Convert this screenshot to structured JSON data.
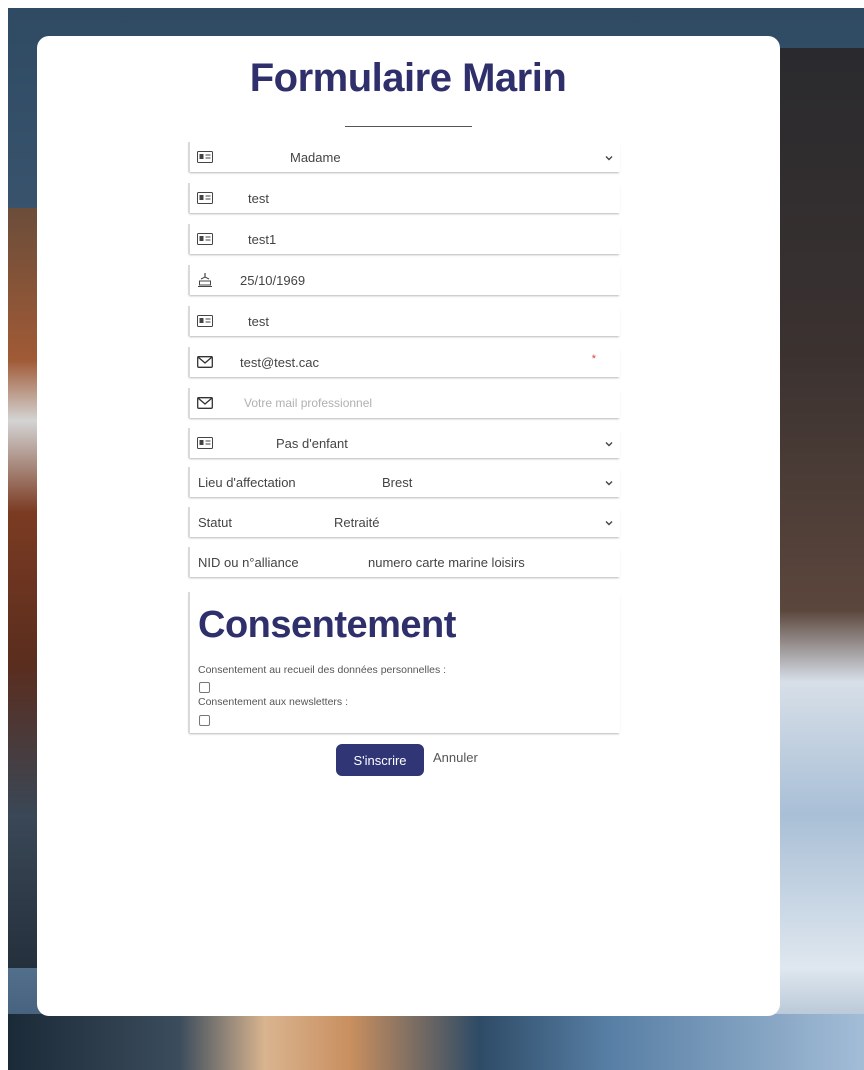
{
  "page": {
    "title": "Formulaire Marin"
  },
  "form": {
    "civility": {
      "value": "Madame",
      "icon": "id-card-icon"
    },
    "first_name": {
      "value": "test",
      "icon": "id-card-icon"
    },
    "last_name": {
      "value": "test1",
      "icon": "id-card-icon"
    },
    "birth_date": {
      "value": "25/10/1969",
      "icon": "cake-icon"
    },
    "field5": {
      "value": "test",
      "icon": "id-card-icon"
    },
    "email": {
      "value": "test@test.cac",
      "required_mark": "*",
      "icon": "mail-icon"
    },
    "pro_email": {
      "placeholder": "Votre mail professionnel",
      "icon": "mail-icon"
    },
    "children": {
      "value": "Pas d'enfant",
      "icon": "id-card-icon"
    },
    "assignment": {
      "label": "Lieu d'affectation",
      "value": "Brest"
    },
    "status": {
      "label": "Statut",
      "value": "Retraité"
    },
    "nid": {
      "label": "NID ou n°alliance",
      "placeholder": "numero carte marine loisirs"
    }
  },
  "consent": {
    "title": "Consentement",
    "personal_data_label": "Consentement au recueil des données personnelles :",
    "newsletter_label": "Consentement aux newsletters :"
  },
  "actions": {
    "submit_label": "S'inscrire",
    "cancel_label": "Annuler"
  },
  "colors": {
    "accent": "#2e2f6b",
    "button": "#2f3575",
    "required": "#d9463b"
  }
}
